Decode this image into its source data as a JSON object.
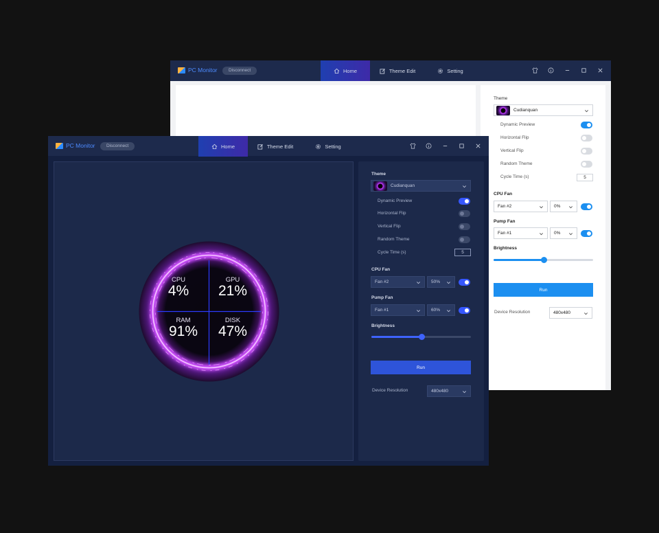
{
  "app": {
    "title": "PC Monitor",
    "status_button": "Disconnect",
    "tabs": [
      {
        "label": "Home",
        "icon": "home-icon",
        "active": true
      },
      {
        "label": "Theme Edit",
        "icon": "edit-icon",
        "active": false
      },
      {
        "label": "Setting",
        "icon": "gear-icon",
        "active": false
      }
    ],
    "window_controls": [
      "shirt-icon",
      "info-icon",
      "minimize-icon",
      "maximize-icon",
      "close-icon"
    ]
  },
  "panel": {
    "theme_label": "Theme",
    "theme_value": "Cudianquan",
    "options": [
      {
        "label": "Dynamic Preview",
        "on": true
      },
      {
        "label": "Horizontal Flip",
        "on": false
      },
      {
        "label": "Vertical Flip",
        "on": false
      },
      {
        "label": "Random Theme",
        "on": false
      }
    ],
    "cycle_time_label": "Cycle Time (s)",
    "cycle_time_value": "5",
    "cpu_fan_label": "CPU Fan",
    "pump_fan_label": "Pump Fan",
    "brightness_label": "Brightness",
    "brightness_value": 0.5,
    "run_label": "Run",
    "device_resolution_label": "Device Resolution",
    "device_resolution_value": "480x480"
  },
  "back_window": {
    "cpu_fan": {
      "fan": "Fan #2",
      "speed": "0%",
      "on": true
    },
    "pump_fan": {
      "fan": "Fan #1",
      "speed": "0%",
      "on": true
    }
  },
  "front_window": {
    "cpu_fan": {
      "fan": "Fan #2",
      "speed": "50%",
      "on": true
    },
    "pump_fan": {
      "fan": "Fan #1",
      "speed": "60%",
      "on": true
    }
  },
  "gauge": [
    {
      "label": "CPU",
      "value": "4%"
    },
    {
      "label": "GPU",
      "value": "21%"
    },
    {
      "label": "RAM",
      "value": "91%"
    },
    {
      "label": "DISK",
      "value": "47%"
    }
  ],
  "colors": {
    "background": "#121212",
    "dark_panel": "#1c294a",
    "accent_blue": "#3657ff",
    "light_accent": "#1c8ff0",
    "ring_purple": "#c23cff"
  }
}
